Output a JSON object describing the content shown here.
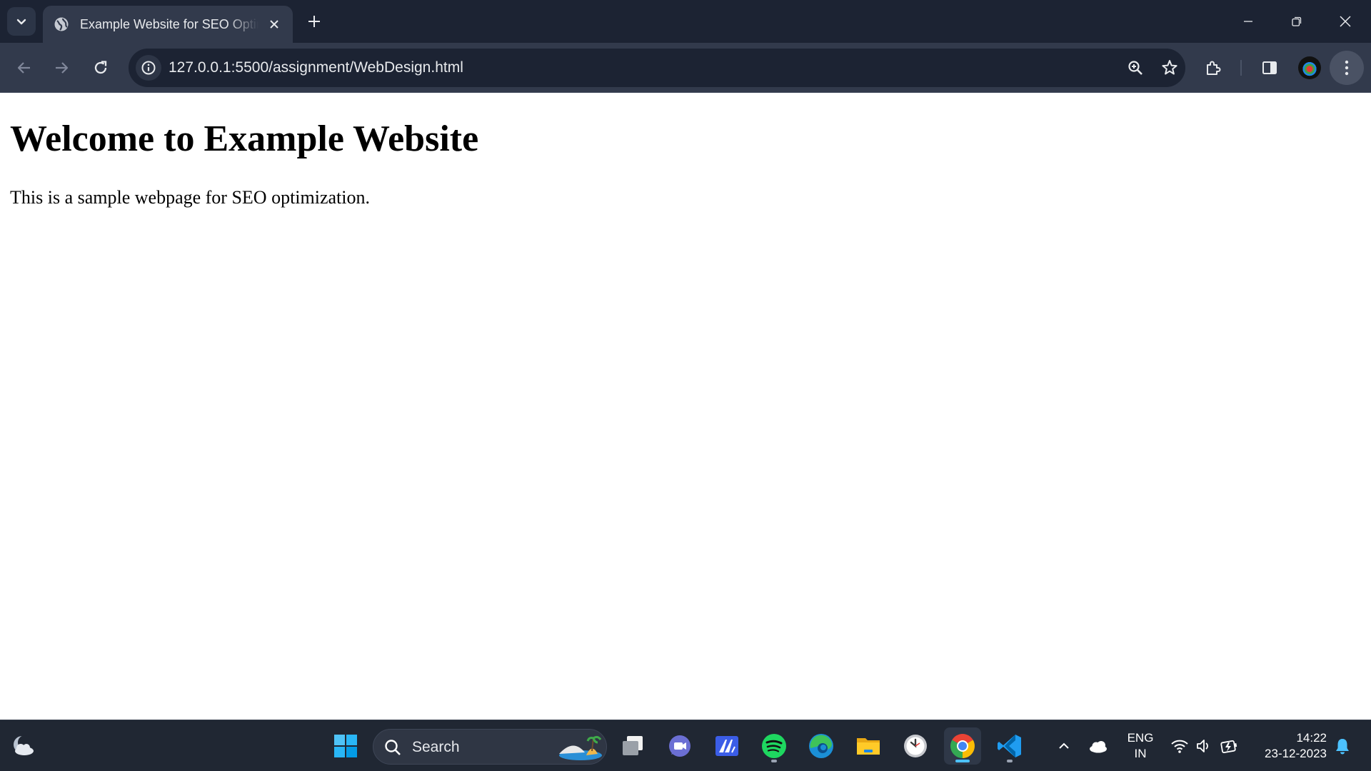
{
  "browser": {
    "tab": {
      "title": "Example Website for SEO Optimization",
      "favicon": "globe-icon"
    },
    "address_bar": {
      "url": "127.0.0.1:5500/assignment/WebDesign.html",
      "site_info_icon": "info-icon"
    },
    "toolbar_icons": [
      "back-icon",
      "forward-icon",
      "reload-icon",
      "zoom-icon",
      "bookmark-star-icon",
      "extensions-icon",
      "side-panel-icon",
      "profile-avatar",
      "menu-icon"
    ],
    "window_controls": [
      "minimize-icon",
      "restore-icon",
      "close-icon"
    ]
  },
  "page": {
    "heading": "Welcome to Example Website",
    "paragraph": "This is a sample webpage for SEO optimization."
  },
  "taskbar": {
    "search_label": "Search",
    "apps": [
      "start-menu",
      "task-view",
      "teams-chat",
      "microsoft-store",
      "spotify",
      "edge",
      "file-explorer",
      "clock",
      "chrome",
      "vscode"
    ],
    "running_apps": [
      "spotify",
      "chrome",
      "vscode"
    ],
    "active_app": "chrome",
    "language": {
      "line1": "ENG",
      "line2": "IN"
    },
    "clock": {
      "time": "14:22",
      "date": "23-12-2023"
    },
    "accent_color": "#4cc2ff"
  }
}
